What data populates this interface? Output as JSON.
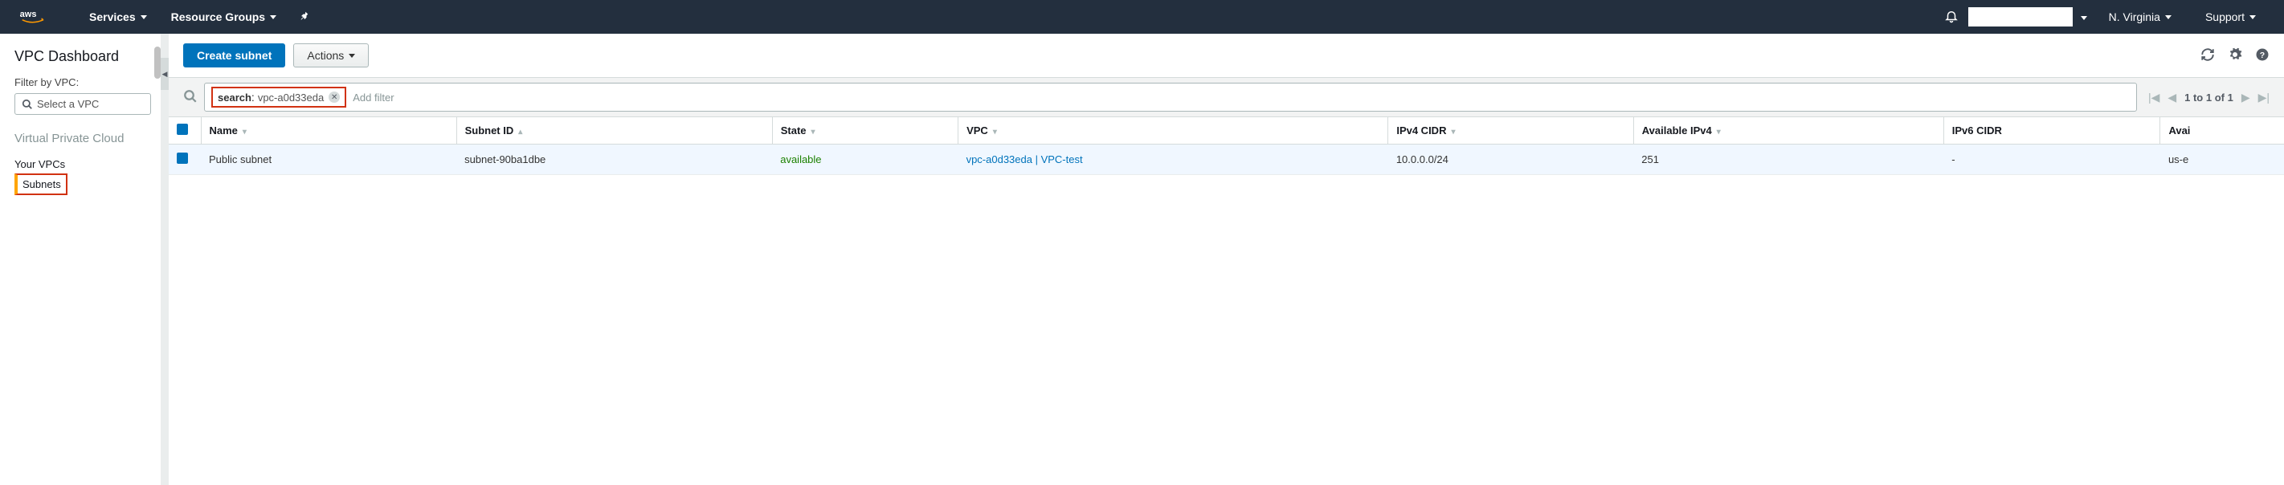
{
  "topnav": {
    "services": "Services",
    "resource_groups": "Resource Groups",
    "region": "N. Virginia",
    "support": "Support"
  },
  "sidebar": {
    "title": "VPC Dashboard",
    "filter_label": "Filter by VPC:",
    "vpc_select_placeholder": "Select a VPC",
    "section_vpc": "Virtual Private Cloud",
    "link_vpcs": "Your VPCs",
    "link_subnets": "Subnets"
  },
  "actions": {
    "create": "Create subnet",
    "actions_label": "Actions"
  },
  "search": {
    "tag_key": "search",
    "tag_value": "vpc-a0d33eda",
    "placeholder": "Add filter",
    "pagination_text": "1 to 1 of 1"
  },
  "table": {
    "headers": {
      "name": "Name",
      "subnet_id": "Subnet ID",
      "state": "State",
      "vpc": "VPC",
      "ipv4_cidr": "IPv4 CIDR",
      "available_ipv4": "Available IPv4",
      "ipv6_cidr": "IPv6 CIDR",
      "avail": "Avai"
    },
    "rows": [
      {
        "name": "Public subnet",
        "subnet_id": "subnet-90ba1dbe",
        "state": "available",
        "vpc": "vpc-a0d33eda | VPC-test",
        "ipv4_cidr": "10.0.0.0/24",
        "available_ipv4": "251",
        "ipv6_cidr": "-",
        "avail": "us-e"
      }
    ]
  }
}
